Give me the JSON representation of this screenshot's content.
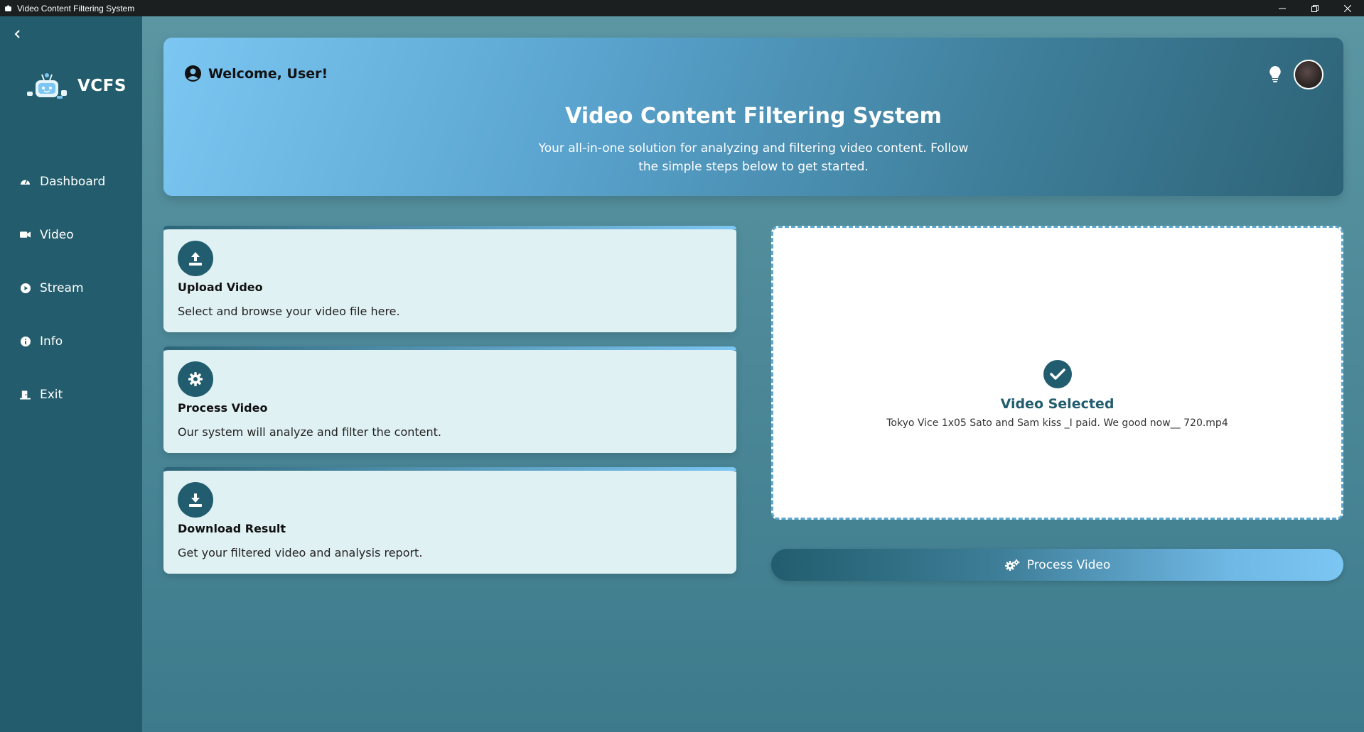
{
  "window": {
    "title": "Video Content Filtering System",
    "controls": [
      "minimize-icon",
      "restore-icon",
      "close-icon"
    ]
  },
  "sidebar": {
    "back_icon": "chevron-left-icon",
    "logo_text": "VCFS",
    "items": [
      {
        "label": "Dashboard",
        "icon": "gauge-icon"
      },
      {
        "label": "Video",
        "icon": "video-camera-icon"
      },
      {
        "label": "Stream",
        "icon": "play-circle-icon"
      },
      {
        "label": "Info",
        "icon": "info-circle-icon"
      },
      {
        "label": "Exit",
        "icon": "door-exit-icon"
      }
    ]
  },
  "header": {
    "welcome": "Welcome, User!",
    "title": "Video Content Filtering System",
    "subtitle": "Your all-in-one solution for analyzing and filtering video content. Follow the simple steps below to get started."
  },
  "steps": [
    {
      "title": "Upload Video",
      "description": "Select and browse your video file here.",
      "icon": "upload-icon"
    },
    {
      "title": "Process Video",
      "description": "Our system will analyze and filter the content.",
      "icon": "gear-icon"
    },
    {
      "title": "Download Result",
      "description": "Get your filtered video and analysis report.",
      "icon": "download-icon"
    }
  ],
  "video_panel": {
    "status": "Video Selected",
    "filename": "Tokyo Vice 1x05 Sato and Sam kiss _I paid. We good now__ 720.mp4"
  },
  "process_button": {
    "label": "Process Video",
    "icon": "gears-icon"
  },
  "colors": {
    "sidebar": "#235c6c",
    "accent_dark": "#215d6e",
    "accent_light": "#7cc6f3",
    "card_bg": "#e0f1f4",
    "dashed_border": "#5da8cc"
  }
}
